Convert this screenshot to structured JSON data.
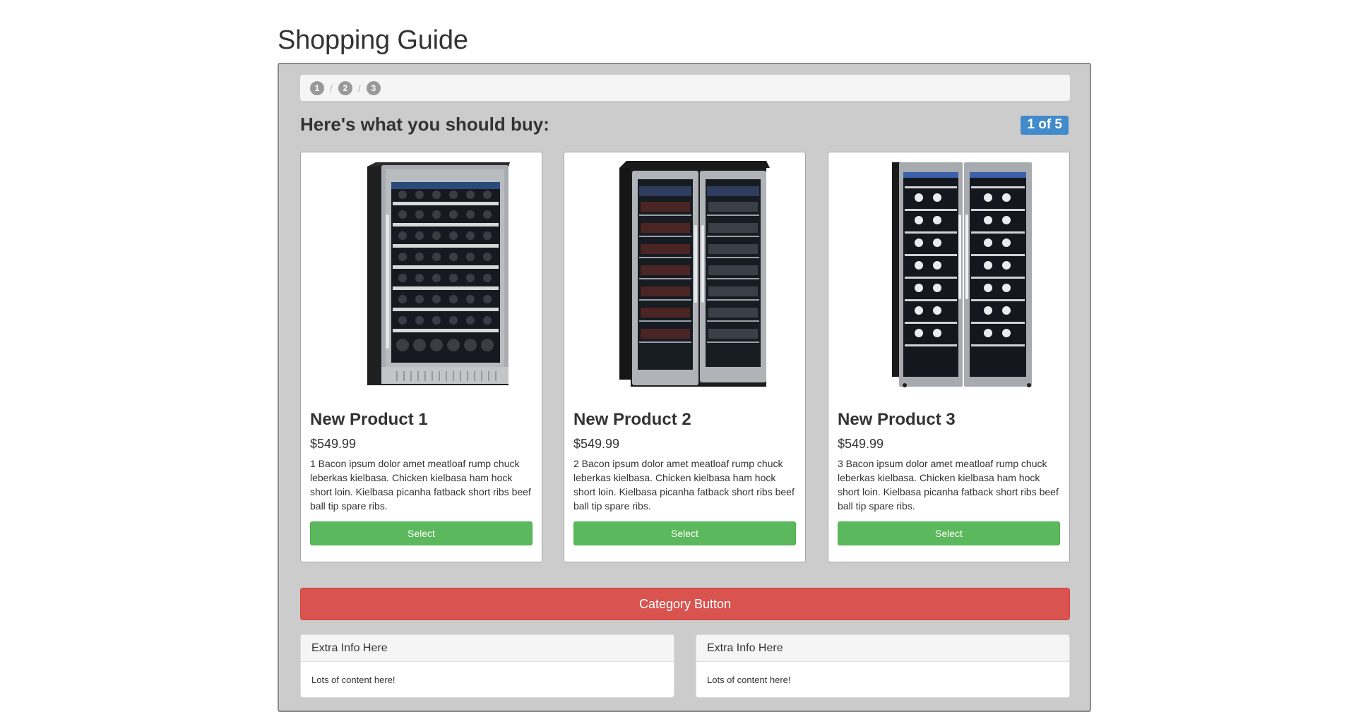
{
  "title": "Shopping Guide",
  "steps": [
    "1",
    "2",
    "3"
  ],
  "step_separator": "/",
  "heading": "Here's what you should buy:",
  "counter": "1 of 5",
  "products": [
    {
      "name": "New Product 1",
      "price": "$549.99",
      "description": "1 Bacon ipsum dolor amet meatloaf rump chuck leberkas kielbasa. Chicken kielbasa ham hock short loin. Kielbasa picanha fatback short ribs beef ball tip spare ribs.",
      "button": "Select",
      "image": "single-door-wine-cooler-image"
    },
    {
      "name": "New Product 2",
      "price": "$549.99",
      "description": "2 Bacon ipsum dolor amet meatloaf rump chuck leberkas kielbasa. Chicken kielbasa ham hock short loin. Kielbasa picanha fatback short ribs beef ball tip spare ribs.",
      "button": "Select",
      "image": "double-door-wine-cooler-image"
    },
    {
      "name": "New Product 3",
      "price": "$549.99",
      "description": "3 Bacon ipsum dolor amet meatloaf rump chuck leberkas kielbasa. Chicken kielbasa ham hock short loin. Kielbasa picanha fatback short ribs beef ball tip spare ribs.",
      "button": "Select",
      "image": "double-door-wine-cooler-image"
    }
  ],
  "category_button": "Category Button",
  "panels": [
    {
      "heading": "Extra Info Here",
      "body": "Lots of content here!"
    },
    {
      "heading": "Extra Info Here",
      "body": "Lots of content here!"
    }
  ],
  "colors": {
    "well": "#cccccc",
    "select_button": "#5cb85c",
    "category_button": "#d9534f",
    "counter_badge": "#428bca"
  }
}
